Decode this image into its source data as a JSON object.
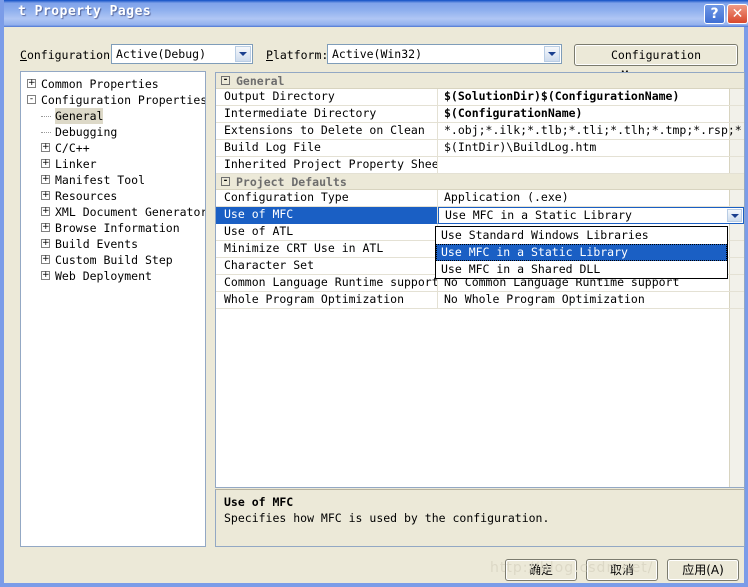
{
  "window": {
    "title": "t Property Pages",
    "help_button": "?",
    "close_button": "✕"
  },
  "toolbar": {
    "configuration_label": "Configuration:",
    "configuration_value": "Active(Debug)",
    "platform_label": "Platform:",
    "platform_value": "Active(Win32)",
    "configuration_manager_label": "Configuration Manager..."
  },
  "tree": {
    "items": [
      {
        "label": "Common Properties",
        "expander": "+",
        "depth": 0,
        "selected": false
      },
      {
        "label": "Configuration Properties",
        "expander": "-",
        "depth": 0,
        "selected": false
      },
      {
        "label": "General",
        "expander": "",
        "depth": 1,
        "selected": true
      },
      {
        "label": "Debugging",
        "expander": "",
        "depth": 1,
        "selected": false
      },
      {
        "label": "C/C++",
        "expander": "+",
        "depth": 1,
        "selected": false
      },
      {
        "label": "Linker",
        "expander": "+",
        "depth": 1,
        "selected": false
      },
      {
        "label": "Manifest Tool",
        "expander": "+",
        "depth": 1,
        "selected": false
      },
      {
        "label": "Resources",
        "expander": "+",
        "depth": 1,
        "selected": false
      },
      {
        "label": "XML Document Generator",
        "expander": "+",
        "depth": 1,
        "selected": false
      },
      {
        "label": "Browse Information",
        "expander": "+",
        "depth": 1,
        "selected": false
      },
      {
        "label": "Build Events",
        "expander": "+",
        "depth": 1,
        "selected": false
      },
      {
        "label": "Custom Build Step",
        "expander": "+",
        "depth": 1,
        "selected": false
      },
      {
        "label": "Web Deployment",
        "expander": "+",
        "depth": 1,
        "selected": false
      }
    ]
  },
  "grid": {
    "categories": [
      {
        "name": "General",
        "expander": "-",
        "rows": [
          {
            "name": "Output Directory",
            "value": "$(SolutionDir)$(ConfigurationName)",
            "bold": true
          },
          {
            "name": "Intermediate Directory",
            "value": "$(ConfigurationName)",
            "bold": true
          },
          {
            "name": "Extensions to Delete on Clean",
            "value": "*.obj;*.ilk;*.tlb;*.tli;*.tlh;*.tmp;*.rsp;*.pgc;*",
            "bold": false
          },
          {
            "name": "Build Log File",
            "value": "$(IntDir)\\BuildLog.htm",
            "bold": false
          },
          {
            "name": "Inherited Project Property Sheets",
            "value": "",
            "bold": false
          }
        ]
      },
      {
        "name": "Project Defaults",
        "expander": "-",
        "rows": [
          {
            "name": "Configuration Type",
            "value": "Application (.exe)",
            "bold": false
          },
          {
            "name": "Use of MFC",
            "value": "Use MFC in a Static Library",
            "bold": false,
            "selected": true,
            "editing": true
          },
          {
            "name": "Use of ATL",
            "value": "",
            "bold": false
          },
          {
            "name": "Minimize CRT Use in ATL",
            "value": "",
            "bold": false
          },
          {
            "name": "Character Set",
            "value": "",
            "bold": false
          },
          {
            "name": "Common Language Runtime support",
            "value": "No Common Language Runtime support",
            "bold": false
          },
          {
            "name": "Whole Program Optimization",
            "value": "No Whole Program Optimization",
            "bold": false
          }
        ]
      }
    ]
  },
  "dropdown": {
    "options": [
      {
        "label": "Use Standard Windows Libraries",
        "selected": false
      },
      {
        "label": "Use MFC in a Static Library",
        "selected": true
      },
      {
        "label": "Use MFC in a Shared DLL",
        "selected": false
      }
    ]
  },
  "description": {
    "title": "Use of MFC",
    "body": "Specifies how MFC is used by the configuration."
  },
  "footer": {
    "ok_label": "确定",
    "cancel_label": "取消",
    "apply_label": "应用(A)",
    "watermark": "http://blog.csdn.net/"
  },
  "colors": {
    "selection_blue": "#1a5fc4",
    "dialog_face": "#ece9d8",
    "title_blue": "#7b9ce8",
    "close_red": "#d8482b"
  }
}
